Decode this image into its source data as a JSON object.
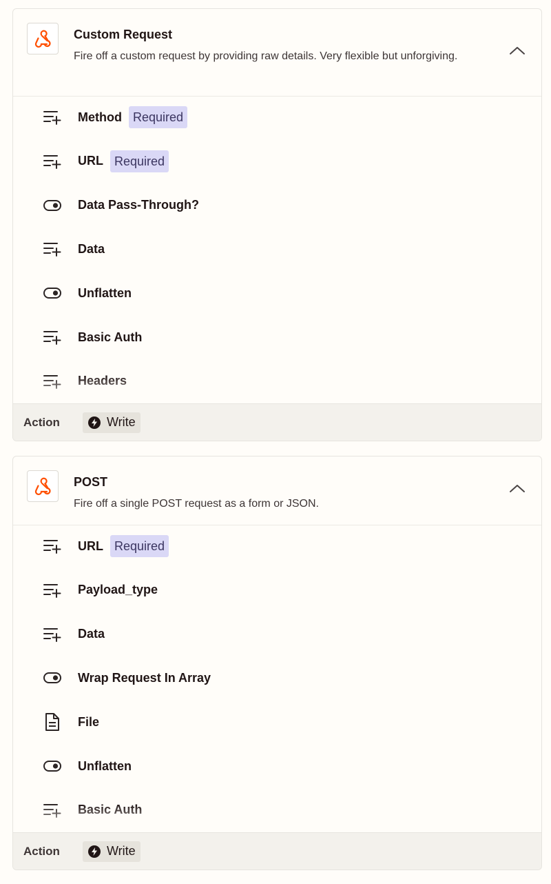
{
  "cards": [
    {
      "title": "Custom Request",
      "description": "Fire off a custom request by providing raw details. Very flexible but unforgiving.",
      "fields": [
        {
          "name": "Method",
          "icon": "text-field-plus-icon",
          "badge": "Required"
        },
        {
          "name": "URL",
          "icon": "text-field-plus-icon",
          "badge": "Required"
        },
        {
          "name": "Data Pass-Through?",
          "icon": "toggle-icon"
        },
        {
          "name": "Data",
          "icon": "text-field-plus-icon"
        },
        {
          "name": "Unflatten",
          "icon": "toggle-icon"
        },
        {
          "name": "Basic Auth",
          "icon": "text-field-plus-icon"
        },
        {
          "name": "Headers",
          "icon": "text-field-plus-icon"
        }
      ],
      "footer_label": "Action",
      "footer_type": "Write"
    },
    {
      "title": "POST",
      "description": "Fire off a single POST request as a form or JSON.",
      "fields": [
        {
          "name": "URL",
          "icon": "text-field-plus-icon",
          "badge": "Required"
        },
        {
          "name": "Payload_type",
          "icon": "text-field-plus-icon"
        },
        {
          "name": "Data",
          "icon": "text-field-plus-icon"
        },
        {
          "name": "Wrap Request In Array",
          "icon": "toggle-icon"
        },
        {
          "name": "File",
          "icon": "file-icon"
        },
        {
          "name": "Unflatten",
          "icon": "toggle-icon"
        },
        {
          "name": "Basic Auth",
          "icon": "text-field-plus-icon"
        }
      ],
      "footer_label": "Action",
      "footer_type": "Write"
    }
  ],
  "colors": {
    "brand_orange": "#ff4f00",
    "badge_bg": "#dad8f6",
    "footer_bg": "#f3f1ec"
  }
}
